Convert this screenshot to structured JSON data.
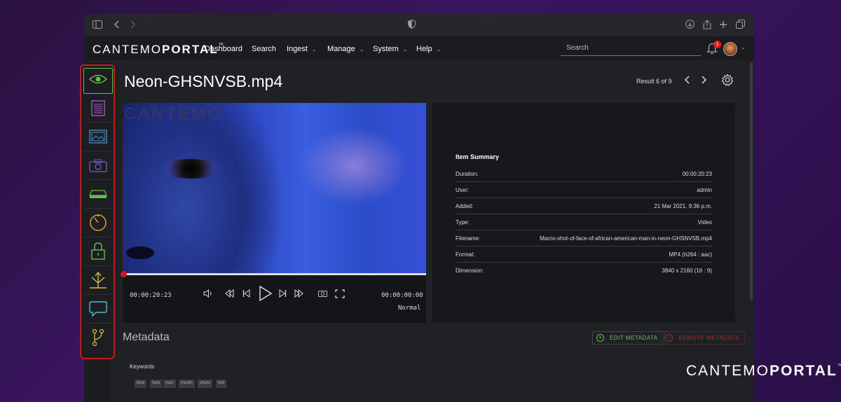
{
  "browser": {
    "sidebar_toggle_icon": "sidebar-icon",
    "back_icon": "chevron-left-icon",
    "forward_icon": "chevron-right-icon",
    "privacy_icon": "shield-icon"
  },
  "app": {
    "logo_light": "CANTEMO",
    "logo_bold": "PORTAL",
    "logo_tm": "™",
    "nav": [
      {
        "label": "Dashboard",
        "has_menu": false
      },
      {
        "label": "Search",
        "has_menu": false
      },
      {
        "label": "Ingest",
        "has_menu": true
      },
      {
        "label": "Manage",
        "has_menu": true
      },
      {
        "label": "System",
        "has_menu": true
      },
      {
        "label": "Help",
        "has_menu": true
      }
    ],
    "search_placeholder": "Search",
    "notifications_count": "1"
  },
  "item": {
    "title": "Neon-GHSNVSB.mp4",
    "result_text": "Result 6 of 9"
  },
  "player": {
    "watermark": "CANTEMO",
    "current_time": "00:00:20:23",
    "end_time": "00:00:00:00",
    "speed": "Normal",
    "progress": 0.0
  },
  "summary": {
    "title": "Item Summary",
    "rows": [
      {
        "key": "Duration:",
        "value": "00:00:20:23"
      },
      {
        "key": "User:",
        "value": "admin"
      },
      {
        "key": "Added:",
        "value": "21 Mar 2021, 9:36 p.m."
      },
      {
        "key": "Type:",
        "value": "Video"
      },
      {
        "key": "Filename:",
        "value": "Macro-shot-of-face-of-african-american-man-in-neon-GHSNVSB.mp4"
      },
      {
        "key": "Format:",
        "value": "MP4 (h264 : aac)"
      },
      {
        "key": "Dimension:",
        "value": "3840 x 2160 (16 : 9)"
      }
    ]
  },
  "metadata": {
    "title": "Metadata",
    "edit_label": "EDIT METADATA",
    "remove_label": "REMOVE METADATA",
    "keywords_label": "Keywords",
    "keywords": [
      "blue",
      "face",
      "man",
      "mouth",
      "photo",
      "red"
    ]
  },
  "sidebar": [
    {
      "icon": "eye-icon",
      "color": "#5fbf4a",
      "active": true
    },
    {
      "icon": "document-icon",
      "color": "#b05ad0"
    },
    {
      "icon": "image-icon",
      "color": "#4a90d0"
    },
    {
      "icon": "camera-icon",
      "color": "#7a5ad0"
    },
    {
      "icon": "storage-icon",
      "color": "#5fbf4a"
    },
    {
      "icon": "timer-icon",
      "color": "#e0a020"
    },
    {
      "icon": "lock-icon",
      "color": "#5fbf4a"
    },
    {
      "icon": "share-icon",
      "color": "#d0c030"
    },
    {
      "icon": "comment-icon",
      "color": "#4ac0d0"
    },
    {
      "icon": "branch-icon",
      "color": "#d0c030"
    }
  ],
  "brand": {
    "light": "CANTEMO",
    "bold": "PORTAL",
    "tm": "™"
  },
  "colors": {
    "highlight": "#cc1818",
    "accent_green": "#5fbf4a",
    "danger": "#c03030"
  }
}
